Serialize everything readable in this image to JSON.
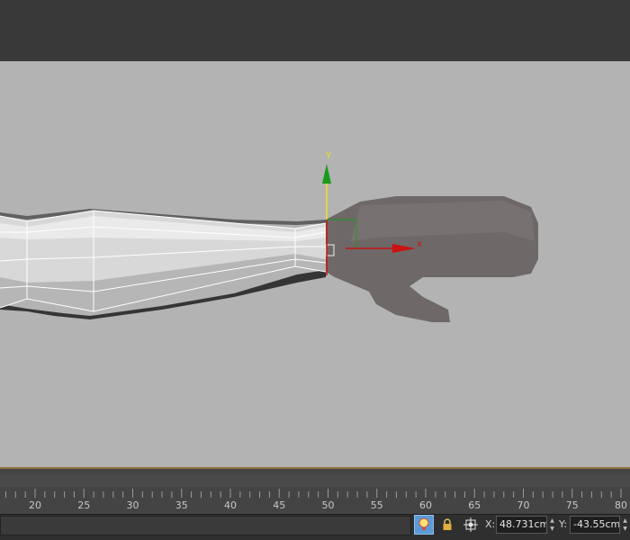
{
  "viewport": {
    "gizmo": {
      "y_axis_label": "Y",
      "x_axis_label": "x"
    },
    "colors": {
      "background": "#b3b3b3",
      "y_axis": "#1a9a1a",
      "x_axis": "#cc1111",
      "selection_edges": "#ffffff",
      "hand_mesh": "#6e6868"
    }
  },
  "timeline": {
    "tick_labels": [
      "20",
      "25",
      "30",
      "35",
      "40",
      "45",
      "50",
      "55",
      "60",
      "65",
      "70",
      "75",
      "80"
    ]
  },
  "status_bar": {
    "selection_lock_icon": "lock-icon",
    "absolute_mode_icon": "transform-mode-icon",
    "x_label": "X:",
    "x_value": "48.731cm",
    "y_label": "Y:",
    "y_value": "-43.55cm"
  }
}
